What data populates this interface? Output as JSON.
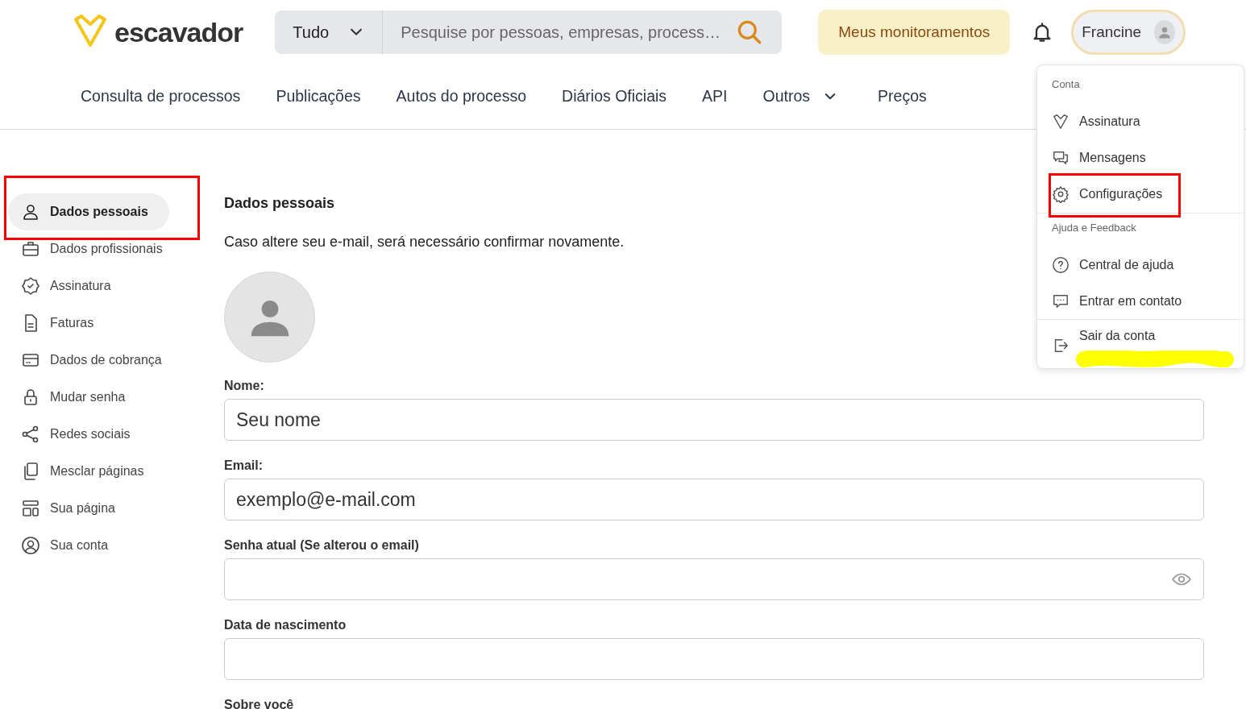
{
  "header": {
    "logo": "escavador",
    "search": {
      "scope": "Tudo",
      "placeholder": "Pesquise por pessoas, empresas, process…"
    },
    "monitor_button": "Meus monitoramentos",
    "user": {
      "name": "Francine"
    }
  },
  "nav": [
    {
      "label": "Consulta de processos",
      "dropdown": false
    },
    {
      "label": "Publicações",
      "dropdown": false
    },
    {
      "label": "Autos do processo",
      "dropdown": false
    },
    {
      "label": "Diários Oficiais",
      "dropdown": false
    },
    {
      "label": "API",
      "dropdown": false
    },
    {
      "label": "Outros",
      "dropdown": true
    },
    {
      "label": "Preços",
      "dropdown": false
    }
  ],
  "sidebar": [
    {
      "label": "Dados pessoais",
      "selected": true,
      "highlighted": true
    },
    {
      "label": "Dados profissionais",
      "selected": false,
      "highlighted": false
    },
    {
      "label": "Assinatura",
      "selected": false,
      "highlighted": false
    },
    {
      "label": "Faturas",
      "selected": false,
      "highlighted": false
    },
    {
      "label": "Dados de cobrança",
      "selected": false,
      "highlighted": false
    },
    {
      "label": "Mudar senha",
      "selected": false,
      "highlighted": false
    },
    {
      "label": "Redes sociais",
      "selected": false,
      "highlighted": false
    },
    {
      "label": "Mesclar páginas",
      "selected": false,
      "highlighted": false
    },
    {
      "label": "Sua página",
      "selected": false,
      "highlighted": false
    },
    {
      "label": "Sua conta",
      "selected": false,
      "highlighted": false
    }
  ],
  "content": {
    "title": "Dados pessoais",
    "note": "Caso altere seu e-mail, será necessário confirmar novamente.",
    "fields": [
      {
        "label": "Nome:",
        "kind": "text",
        "placeholder": "Seu nome"
      },
      {
        "label": "Email:",
        "kind": "text",
        "placeholder": "exemplo@e-mail.com"
      },
      {
        "label": "Senha atual (Se alterou o email)",
        "kind": "password"
      },
      {
        "label": "Data de nascimento",
        "kind": "text"
      }
    ],
    "last_label": "Sobre você"
  },
  "user_menu": {
    "sections": [
      {
        "title": "Conta",
        "items": [
          {
            "label": "Assinatura",
            "highlighted": false
          },
          {
            "label": "Mensagens",
            "highlighted": false
          },
          {
            "label": "Configurações",
            "highlighted": true
          }
        ]
      },
      {
        "title": "Ajuda e Feedback",
        "items": [
          {
            "label": "Central de ajuda",
            "highlighted": false
          },
          {
            "label": "Entrar em contato",
            "highlighted": false
          }
        ]
      },
      {
        "items": [
          {
            "label": "Sair da conta",
            "highlighted": false,
            "redacted": true
          }
        ]
      }
    ]
  }
}
